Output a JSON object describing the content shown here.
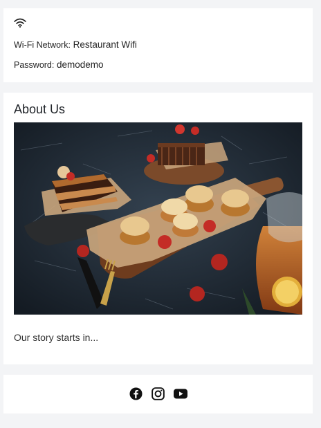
{
  "wifi": {
    "icon": "wifi-icon",
    "network_label": "Wi-Fi Network:",
    "network_name": "Restaurant Wifi",
    "password_label": "Password:",
    "password": "demodemo"
  },
  "about": {
    "title": "About Us",
    "image": "food-photo",
    "text": "Our story starts in..."
  },
  "social": {
    "links": [
      {
        "icon": "facebook-icon"
      },
      {
        "icon": "instagram-icon"
      },
      {
        "icon": "youtube-icon"
      }
    ]
  },
  "colors": {
    "page_background": "#f3f4f6",
    "card_background": "#ffffff",
    "text": "#1f2328",
    "icon": "#111111"
  }
}
